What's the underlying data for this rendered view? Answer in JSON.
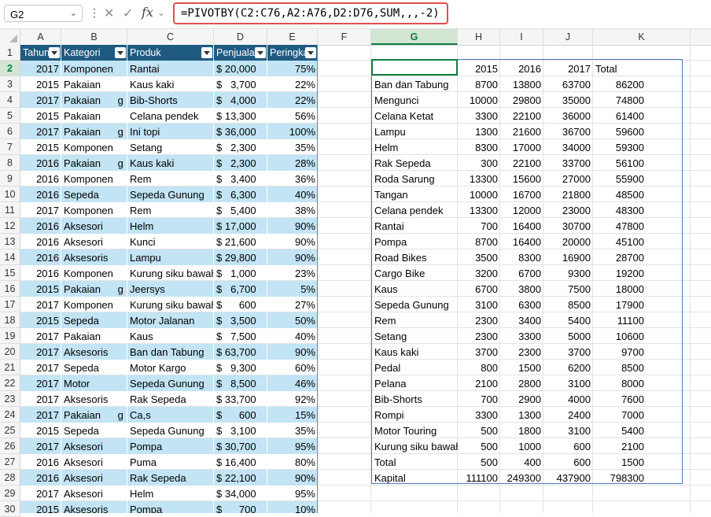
{
  "formula_bar": {
    "name_box": "G2",
    "formula": "=PIVOTBY(C2:C76,A2:A76,D2:D76,SUM,,,-2)",
    "fx_label": "fx",
    "cancel_glyph": "✕",
    "enter_glyph": "✓",
    "more_glyph": "⋮",
    "dropdown_glyph": "⌄"
  },
  "columns": [
    "A",
    "B",
    "C",
    "D",
    "E",
    "F",
    "G",
    "H",
    "I",
    "J",
    "K"
  ],
  "selected_column": "G",
  "selected_row": "2",
  "rows": [
    "1",
    "2",
    "3",
    "4",
    "5",
    "6",
    "7",
    "8",
    "9",
    "10",
    "11",
    "12",
    "13",
    "14",
    "15",
    "16",
    "17",
    "18",
    "19",
    "20",
    "21",
    "22",
    "23",
    "24",
    "25",
    "26",
    "27",
    "28",
    "29",
    "30"
  ],
  "table": {
    "headers": [
      "Tahun",
      "Kategori",
      "Produk",
      "Penjualan",
      "Peringkat"
    ],
    "rows": [
      [
        "2017",
        "Komponen",
        "Rantai",
        "$ 20,000",
        "75%"
      ],
      [
        "2015",
        "Pakaian",
        "Kaus kaki",
        "$   3,700",
        "22%"
      ],
      [
        "2017",
        "Pakaian      g",
        "Bib-Shorts",
        "$   4,000",
        "22%"
      ],
      [
        "2015",
        "Pakaian",
        "Celana pendek",
        "$ 13,300",
        "56%"
      ],
      [
        "2017",
        "Pakaian      g",
        "Ini topi",
        "$ 36,000",
        "100%"
      ],
      [
        "2015",
        "Komponen",
        "Setang",
        "$   2,300",
        "35%"
      ],
      [
        "2016",
        "Pakaian      g",
        "Kaus kaki",
        "$   2,300",
        "28%"
      ],
      [
        "2016",
        "Komponen",
        "Rem",
        "$   3,400",
        "36%"
      ],
      [
        "2016",
        "Sepeda",
        "Sepeda Gunung",
        "$   6,300",
        "40%"
      ],
      [
        "2017",
        "Komponen",
        "Rem",
        "$   5,400",
        "38%"
      ],
      [
        "2016",
        "Aksesori",
        "Helm",
        "$ 17,000",
        "90%"
      ],
      [
        "2016",
        "Aksesori",
        "Kunci",
        "$ 21,600",
        "90%"
      ],
      [
        "2016",
        "Aksesoris",
        "Lampu",
        "$ 29,800",
        "90%"
      ],
      [
        "2016",
        "Komponen",
        "Kurung siku bawah",
        "$   1,000",
        "23%"
      ],
      [
        "2015",
        "Pakaian      g",
        "Jeersys",
        "$   6,700",
        "5%"
      ],
      [
        "2017",
        "Komponen",
        "Kurung siku bawah",
        "$      600",
        "27%"
      ],
      [
        "2015",
        "Sepeda",
        "Motor Jalanan",
        "$   3,500",
        "50%"
      ],
      [
        "2017",
        "Pakaian",
        "Kaus",
        "$   7,500",
        "40%"
      ],
      [
        "2017",
        "Aksesoris",
        "Ban dan Tabung",
        "$ 63,700",
        "90%"
      ],
      [
        "2017",
        "Sepeda",
        "Motor Kargo",
        "$   9,300",
        "60%"
      ],
      [
        "2017",
        "Motor",
        "Sepeda Gunung",
        "$   8,500",
        "46%"
      ],
      [
        "2017",
        "Aksesoris",
        "Rak Sepeda",
        "$ 33,700",
        "92%"
      ],
      [
        "2017",
        "Pakaian      g",
        "Ca,s",
        "$      600",
        "15%"
      ],
      [
        "2015",
        "Sepeda",
        "Sepeda Gunung",
        "$   3,100",
        "35%"
      ],
      [
        "2017",
        "Aksesori",
        "Pompa",
        "$ 30,700",
        "95%"
      ],
      [
        "2016",
        "Aksesori",
        "Puma",
        "$ 16,400",
        "80%"
      ],
      [
        "2016",
        "Aksesori",
        "Rak Sepeda",
        "$ 22,100",
        "90%"
      ],
      [
        "2017",
        "Aksesori",
        "Helm",
        "$ 34,000",
        "95%"
      ],
      [
        "2015",
        "Aksesoris",
        "Pompa",
        "$      700",
        "10%"
      ]
    ]
  },
  "pivot": {
    "headers": [
      "",
      "2015",
      "2016",
      "2017",
      "Total"
    ],
    "rows": [
      [
        "Ban dan Tabung",
        "8700",
        "13800",
        "63700",
        "86200"
      ],
      [
        "Mengunci",
        "10000",
        "29800",
        "35000",
        "74800"
      ],
      [
        "Celana Ketat",
        "3300",
        "22100",
        "36000",
        "61400"
      ],
      [
        "Lampu",
        "1300",
        "21600",
        "36700",
        "59600"
      ],
      [
        "Helm",
        "8300",
        "17000",
        "34000",
        "59300"
      ],
      [
        "Rak Sepeda",
        "300",
        "22100",
        "33700",
        "56100"
      ],
      [
        "Roda Sarung",
        "13300",
        "15600",
        "27000",
        "55900"
      ],
      [
        "Tangan",
        "10000",
        "16700",
        "21800",
        "48500"
      ],
      [
        "Celana pendek",
        "13300",
        "12000",
        "23000",
        "48300"
      ],
      [
        "Rantai",
        "700",
        "16400",
        "30700",
        "47800"
      ],
      [
        "Pompa",
        "8700",
        "16400",
        "20000",
        "45100"
      ],
      [
        "Road Bikes",
        "3500",
        "8300",
        "16900",
        "28700"
      ],
      [
        "Cargo Bike",
        "3200",
        "6700",
        "9300",
        "19200"
      ],
      [
        "Kaus",
        "6700",
        "3800",
        "7500",
        "18000"
      ],
      [
        "Sepeda Gunung",
        "3100",
        "6300",
        "8500",
        "17900"
      ],
      [
        "Rem",
        "2300",
        "3400",
        "5400",
        "11100"
      ],
      [
        "Setang",
        "2300",
        "3300",
        "5000",
        "10600"
      ],
      [
        "Kaus kaki",
        "3700",
        "2300",
        "3700",
        "9700"
      ],
      [
        "Pedal",
        "800",
        "1500",
        "6200",
        "8500"
      ],
      [
        "Pelana",
        "2100",
        "2800",
        "3100",
        "8000"
      ],
      [
        "Bib-Shorts",
        "700",
        "2900",
        "4000",
        "7600"
      ],
      [
        "Rompi",
        "3300",
        "1300",
        "2400",
        "7000"
      ],
      [
        "Motor Touring",
        "500",
        "1800",
        "3100",
        "5400"
      ],
      [
        "Kurung siku bawah",
        "500",
        "1000",
        "600",
        "2100"
      ],
      [
        "Total",
        "500",
        "400",
        "600",
        "1500"
      ],
      [
        "Kapital",
        "111100",
        "249300",
        "437900",
        "798300"
      ]
    ]
  }
}
